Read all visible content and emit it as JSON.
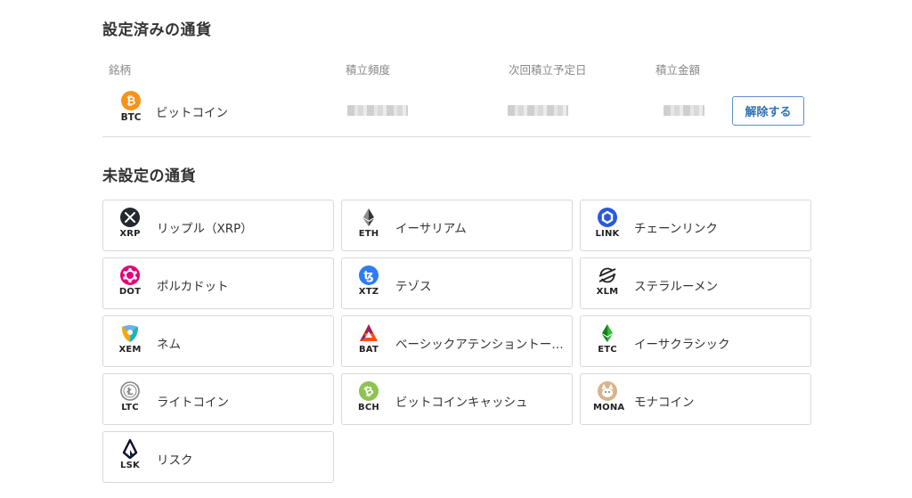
{
  "set_section": {
    "title": "設定済みの通貨",
    "headers": {
      "coin": "銘柄",
      "frequency": "積立頻度",
      "next_date": "次回積立予定日",
      "amount": "積立金額"
    },
    "rows": [
      {
        "symbol": "BTC",
        "name": "ビットコイン",
        "icon": "bitcoin-icon",
        "button": "解除する"
      }
    ]
  },
  "unset_section": {
    "title": "未設定の通貨",
    "coins": [
      {
        "symbol": "XRP",
        "name": "リップル（XRP）",
        "icon": "xrp-icon"
      },
      {
        "symbol": "ETH",
        "name": "イーサリアム",
        "icon": "ethereum-icon"
      },
      {
        "symbol": "LINK",
        "name": "チェーンリンク",
        "icon": "chainlink-icon"
      },
      {
        "symbol": "DOT",
        "name": "ポルカドット",
        "icon": "polkadot-icon"
      },
      {
        "symbol": "XTZ",
        "name": "テゾス",
        "icon": "tezos-icon"
      },
      {
        "symbol": "XLM",
        "name": "ステラルーメン",
        "icon": "stellar-icon"
      },
      {
        "symbol": "XEM",
        "name": "ネム",
        "icon": "nem-icon"
      },
      {
        "symbol": "BAT",
        "name": "ベーシックアテンショントー…",
        "icon": "bat-icon"
      },
      {
        "symbol": "ETC",
        "name": "イーサクラシック",
        "icon": "ethereum-classic-icon"
      },
      {
        "symbol": "LTC",
        "name": "ライトコイン",
        "icon": "litecoin-icon"
      },
      {
        "symbol": "BCH",
        "name": "ビットコインキャッシュ",
        "icon": "bitcoin-cash-icon"
      },
      {
        "symbol": "MONA",
        "name": "モナコイン",
        "icon": "monacoin-icon"
      },
      {
        "symbol": "LSK",
        "name": "リスク",
        "icon": "lisk-icon"
      }
    ]
  },
  "colors": {
    "accent": "#2f6fb5",
    "btc": "#f7931a",
    "bch": "#8dc351",
    "dot": "#e6007a",
    "link": "#2a5ada",
    "xtz": "#2c7df7",
    "bat": "#ff5000",
    "etc": "#3ab83a"
  }
}
